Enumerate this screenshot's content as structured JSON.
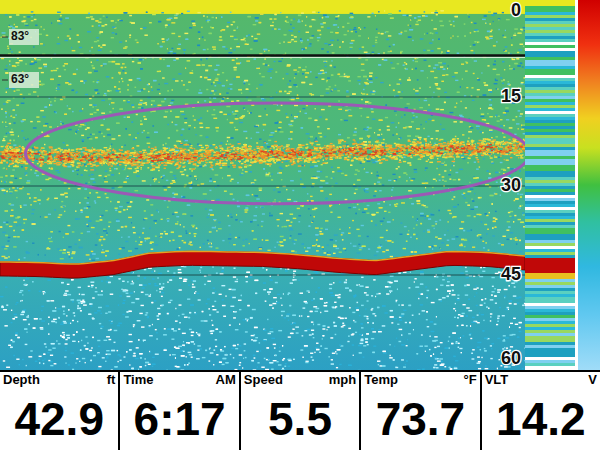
{
  "display": {
    "kind": "fish finder sonar"
  },
  "depth_scale": [
    "0",
    "15",
    "30",
    "45",
    "60"
  ],
  "temperature_marks": [
    "83°",
    "63°"
  ],
  "sonar": {
    "max_depth_ft": 60,
    "surface_clutter_ft": 1,
    "thermocline_depth_ft": 8,
    "bottom_depth_ft": [
      42.8,
      42.9,
      43.2,
      42.6,
      41.3,
      41.0,
      41.1,
      41.2,
      41.6,
      42.2,
      42.6,
      41.8,
      41.0,
      41.2,
      41.8
    ],
    "fish_layer_depth_ft": [
      24.8,
      24.9,
      25.0,
      25.2,
      25.0,
      24.8,
      24.5,
      24.2,
      24.0,
      23.8,
      23.6,
      23.5
    ]
  },
  "highlight_ellipse": {
    "center_depth_ft": 24.5,
    "half_height_ft": 8.5,
    "color": "#9b59b6"
  },
  "readouts": [
    {
      "label": "Depth",
      "unit": "ft",
      "value": "42.9"
    },
    {
      "label": "Time",
      "unit": "AM",
      "value": "6:17"
    },
    {
      "label": "Speed",
      "unit": "mph",
      "value": "5.5"
    },
    {
      "label": "Temp",
      "unit": "°F",
      "value": "73.7"
    },
    {
      "label": "VLT",
      "unit": "V",
      "value": "14.2"
    }
  ]
}
